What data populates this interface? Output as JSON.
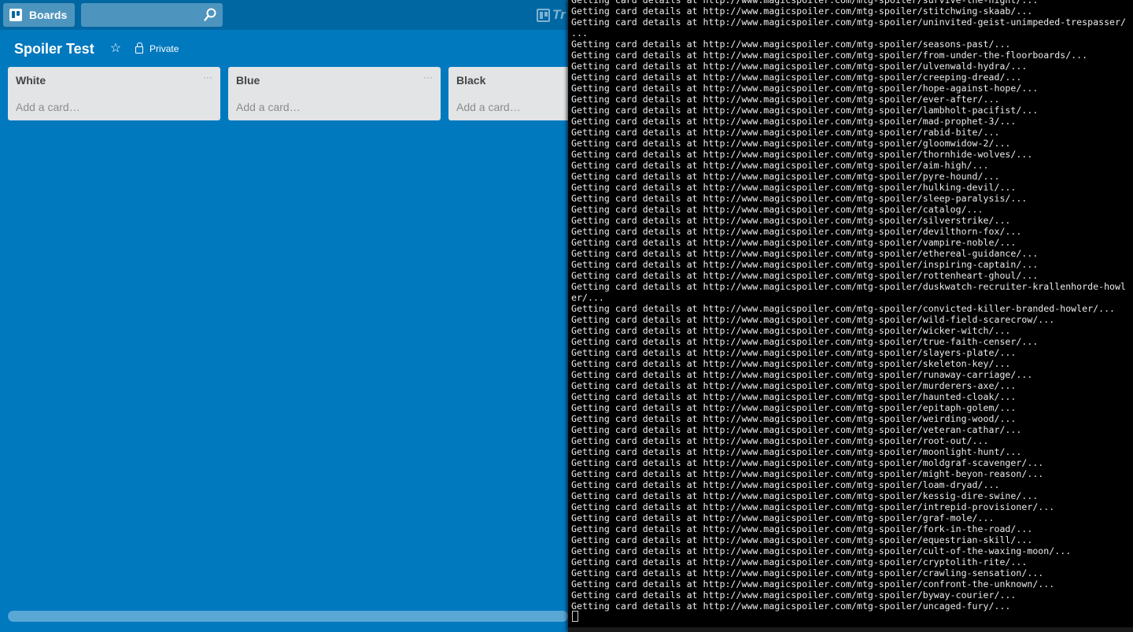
{
  "header": {
    "boards_label": "Boards",
    "search_placeholder": "",
    "logo_text": "Tr"
  },
  "board": {
    "title": "Spoiler Test",
    "privacy_label": "Private"
  },
  "lists": [
    {
      "title": "White",
      "menu": "···",
      "add_card": "Add a card…"
    },
    {
      "title": "Blue",
      "menu": "···",
      "add_card": "Add a card…"
    },
    {
      "title": "Black",
      "menu": "···",
      "add_card": "Add a card…"
    }
  ],
  "terminal": {
    "lines": [
      "Getting card details at http://www.magicspoiler.com/mtg-spoiler/survive-the-night/...",
      "Getting card details at http://www.magicspoiler.com/mtg-spoiler/stitchwing-skaab/...",
      "Getting card details at http://www.magicspoiler.com/mtg-spoiler/uninvited-geist-unimpeded-trespasser/",
      "...",
      "Getting card details at http://www.magicspoiler.com/mtg-spoiler/seasons-past/...",
      "Getting card details at http://www.magicspoiler.com/mtg-spoiler/from-under-the-floorboards/...",
      "Getting card details at http://www.magicspoiler.com/mtg-spoiler/ulvenwald-hydra/...",
      "Getting card details at http://www.magicspoiler.com/mtg-spoiler/creeping-dread/...",
      "Getting card details at http://www.magicspoiler.com/mtg-spoiler/hope-against-hope/...",
      "Getting card details at http://www.magicspoiler.com/mtg-spoiler/ever-after/...",
      "Getting card details at http://www.magicspoiler.com/mtg-spoiler/lambholt-pacifist/...",
      "Getting card details at http://www.magicspoiler.com/mtg-spoiler/mad-prophet-3/...",
      "Getting card details at http://www.magicspoiler.com/mtg-spoiler/rabid-bite/...",
      "Getting card details at http://www.magicspoiler.com/mtg-spoiler/gloomwidow-2/...",
      "Getting card details at http://www.magicspoiler.com/mtg-spoiler/thornhide-wolves/...",
      "Getting card details at http://www.magicspoiler.com/mtg-spoiler/aim-high/...",
      "Getting card details at http://www.magicspoiler.com/mtg-spoiler/pyre-hound/...",
      "Getting card details at http://www.magicspoiler.com/mtg-spoiler/hulking-devil/...",
      "Getting card details at http://www.magicspoiler.com/mtg-spoiler/sleep-paralysis/...",
      "Getting card details at http://www.magicspoiler.com/mtg-spoiler/catalog/...",
      "Getting card details at http://www.magicspoiler.com/mtg-spoiler/silverstrike/...",
      "Getting card details at http://www.magicspoiler.com/mtg-spoiler/devilthorn-fox/...",
      "Getting card details at http://www.magicspoiler.com/mtg-spoiler/vampire-noble/...",
      "Getting card details at http://www.magicspoiler.com/mtg-spoiler/ethereal-guidance/...",
      "Getting card details at http://www.magicspoiler.com/mtg-spoiler/inspiring-captain/...",
      "Getting card details at http://www.magicspoiler.com/mtg-spoiler/rottenheart-ghoul/...",
      "Getting card details at http://www.magicspoiler.com/mtg-spoiler/duskwatch-recruiter-krallenhorde-howl",
      "er/...",
      "Getting card details at http://www.magicspoiler.com/mtg-spoiler/convicted-killer-branded-howler/...",
      "Getting card details at http://www.magicspoiler.com/mtg-spoiler/wild-field-scarecrow/...",
      "Getting card details at http://www.magicspoiler.com/mtg-spoiler/wicker-witch/...",
      "Getting card details at http://www.magicspoiler.com/mtg-spoiler/true-faith-censer/...",
      "Getting card details at http://www.magicspoiler.com/mtg-spoiler/slayers-plate/...",
      "Getting card details at http://www.magicspoiler.com/mtg-spoiler/skeleton-key/...",
      "Getting card details at http://www.magicspoiler.com/mtg-spoiler/runaway-carriage/...",
      "Getting card details at http://www.magicspoiler.com/mtg-spoiler/murderers-axe/...",
      "Getting card details at http://www.magicspoiler.com/mtg-spoiler/haunted-cloak/...",
      "Getting card details at http://www.magicspoiler.com/mtg-spoiler/epitaph-golem/...",
      "Getting card details at http://www.magicspoiler.com/mtg-spoiler/weirding-wood/...",
      "Getting card details at http://www.magicspoiler.com/mtg-spoiler/veteran-cathar/...",
      "Getting card details at http://www.magicspoiler.com/mtg-spoiler/root-out/...",
      "Getting card details at http://www.magicspoiler.com/mtg-spoiler/moonlight-hunt/...",
      "Getting card details at http://www.magicspoiler.com/mtg-spoiler/moldgraf-scavenger/...",
      "Getting card details at http://www.magicspoiler.com/mtg-spoiler/might-beyon-reason/...",
      "Getting card details at http://www.magicspoiler.com/mtg-spoiler/loam-dryad/...",
      "Getting card details at http://www.magicspoiler.com/mtg-spoiler/kessig-dire-swine/...",
      "Getting card details at http://www.magicspoiler.com/mtg-spoiler/intrepid-provisioner/...",
      "Getting card details at http://www.magicspoiler.com/mtg-spoiler/graf-mole/...",
      "Getting card details at http://www.magicspoiler.com/mtg-spoiler/fork-in-the-road/...",
      "Getting card details at http://www.magicspoiler.com/mtg-spoiler/equestrian-skill/...",
      "Getting card details at http://www.magicspoiler.com/mtg-spoiler/cult-of-the-waxing-moon/...",
      "Getting card details at http://www.magicspoiler.com/mtg-spoiler/cryptolith-rite/...",
      "Getting card details at http://www.magicspoiler.com/mtg-spoiler/crawling-sensation/...",
      "Getting card details at http://www.magicspoiler.com/mtg-spoiler/confront-the-unknown/...",
      "Getting card details at http://www.magicspoiler.com/mtg-spoiler/byway-courier/...",
      "Getting card details at http://www.magicspoiler.com/mtg-spoiler/uncaged-fury/..."
    ]
  }
}
